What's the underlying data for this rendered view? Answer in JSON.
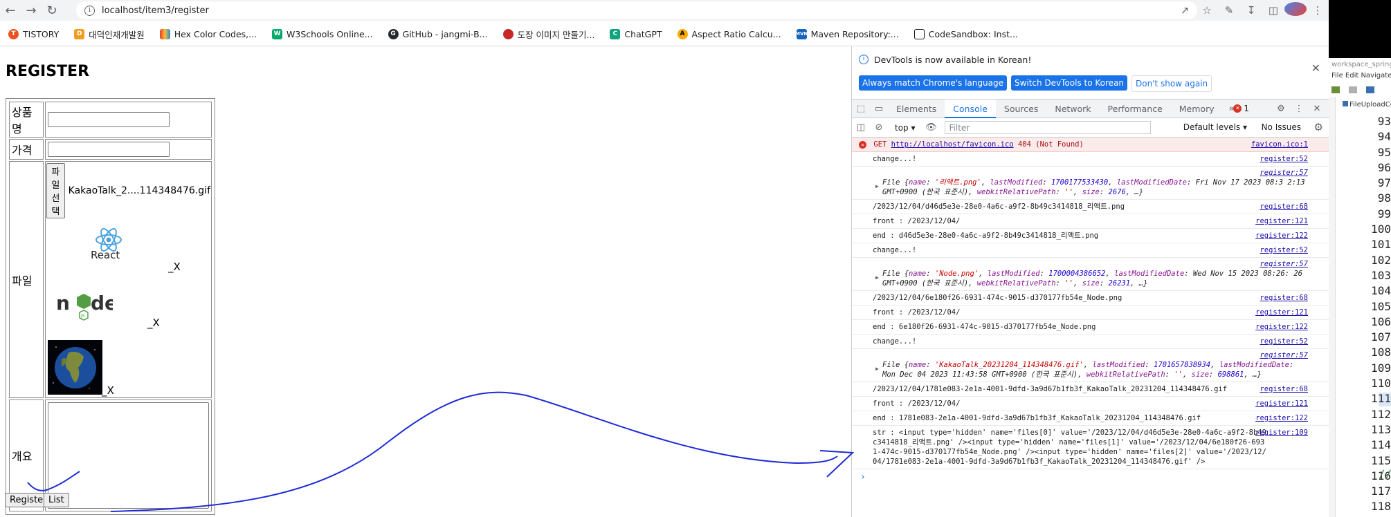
{
  "browser": {
    "url": "localhost/item3/register",
    "bookmarks": [
      {
        "label": "TISTORY",
        "color": "#eb531f",
        "glyph": "T"
      },
      {
        "label": "대덕인재개발원",
        "color": "#f29c1f",
        "glyph": "D"
      },
      {
        "label": "Hex Color Codes,...",
        "color": "#e53935",
        "glyph": "H"
      },
      {
        "label": "W3Schools Online...",
        "color": "#04aa6d",
        "glyph": "W"
      },
      {
        "label": "GitHub - jangmi-B...",
        "color": "#24292f",
        "glyph": "G"
      },
      {
        "label": "도장 이미지 만들기...",
        "color": "#c62828",
        "glyph": "도"
      },
      {
        "label": "ChatGPT",
        "color": "#10a37f",
        "glyph": "C"
      },
      {
        "label": "Aspect Ratio Calcu...",
        "color": "#f9ab00",
        "glyph": "A"
      },
      {
        "label": "Maven Repository:...",
        "color": "#1565c0",
        "glyph": "M"
      },
      {
        "label": "CodeSandbox: Inst...",
        "color": "#151515",
        "glyph": "□"
      }
    ]
  },
  "page": {
    "title": "REGISTER",
    "labels": {
      "name": "상품명",
      "price": "가격",
      "file": "파일",
      "desc": "개요"
    },
    "name_value": "",
    "price_value": "",
    "file_button": "파일 선택",
    "file_name": "KakaoTalk_2....114348476.gif",
    "thumbs": [
      {
        "name": "React",
        "x_label": "_X",
        "icon": "react-logo"
      },
      {
        "name": "node",
        "x_label": "_X",
        "icon": "node-logo"
      },
      {
        "name": "earth",
        "x_label": "_X",
        "icon": "earth-image"
      }
    ],
    "register_button": "Register",
    "list_button": "List"
  },
  "devtools": {
    "notice": "DevTools is now available in Korean!",
    "btn_match": "Always match Chrome's language",
    "btn_switch": "Switch DevTools to Korean",
    "btn_dont_show": "Don't show again",
    "tabs": [
      "Elements",
      "Console",
      "Sources",
      "Network",
      "Performance",
      "Memory"
    ],
    "active_tab": "Console",
    "error_count": "1",
    "context": "top",
    "filter_placeholder": "Filter",
    "levels": "Default levels",
    "issues": "No Issues",
    "error": {
      "method": "GET",
      "url": "http://localhost/favicon.ico",
      "status": "404 (Not Found)",
      "source": "favicon.ico:1"
    },
    "messages": [
      {
        "text": "change...!",
        "source": "register:52"
      },
      {
        "obj": true,
        "source": "register:57",
        "file_name": "'리액트.png'",
        "last_modified": "1700177533430",
        "date": "Fri Nov 17 2023 08:3 2:13 GMT+0900 (한국 표준시)",
        "size": "2676"
      },
      {
        "text": "/2023/12/04/d46d5e3e-28e0-4a6c-a9f2-8b49c3414818_리액트.png",
        "source": "register:68"
      },
      {
        "text": "front : /2023/12/04/",
        "source": "register:121"
      },
      {
        "text": "end : d46d5e3e-28e0-4a6c-a9f2-8b49c3414818_리액트.png",
        "source": "register:122"
      },
      {
        "text": "change...!",
        "source": "register:52"
      },
      {
        "obj": true,
        "source": "register:57",
        "file_name": "'Node.png'",
        "last_modified": "1700004386652",
        "date": "Wed Nov 15 2023 08:26: 26 GMT+0900 (한국 표준시)",
        "size": "26231"
      },
      {
        "text": "/2023/12/04/6e180f26-6931-474c-9015-d370177fb54e_Node.png",
        "source": "register:68"
      },
      {
        "text": "front : /2023/12/04/",
        "source": "register:121"
      },
      {
        "text": "end : 6e180f26-6931-474c-9015-d370177fb54e_Node.png",
        "source": "register:122"
      },
      {
        "text": "change...!",
        "source": "register:52"
      },
      {
        "obj": true,
        "source": "register:57",
        "file_name": "'KakaoTalk_20231204_114348476.gif'",
        "last_modified": "1701657838934",
        "date": "Mon Dec 04 2023 11:43:58 GMT+0900 (한국 표준시)",
        "size": "698861"
      },
      {
        "text": "/2023/12/04/1781e083-2e1a-4001-9dfd-3a9d67b1fb3f_KakaoTalk_20231204_114348476.gif",
        "source": "register:68"
      },
      {
        "text": "front : /2023/12/04/",
        "source": "register:121"
      },
      {
        "text": "end : 1781e083-2e1a-4001-9dfd-3a9d67b1fb3f_KakaoTalk_20231204_114348476.gif",
        "source": "register:122"
      },
      {
        "text": "str : <input type='hidden' name='files[0]' value='/2023/12/04/d46d5e3e-28e0-4a6c-a9f2-8b49c3414818_리액트.png' /><input type='hidden' name='files[1]' value='/2023/12/04/6e180f26-6931-474c-9015-d370177fb54e_Node.png' /><input type='hidden' name='files[2]' value='/2023/12/04/1781e083-2e1a-4001-9dfd-3a9d67b1fb3f_KakaoTalk_20231204_114348476.gif' />",
        "source": "register:109"
      }
    ]
  },
  "ide": {
    "title": "workspace_spring",
    "menu": "File  Edit  Navigate",
    "tab": "FileUploadCo",
    "line_numbers": [
      "93",
      "94",
      "95",
      "96",
      "97",
      "98",
      "99",
      "100",
      "101",
      "102",
      "103",
      "104",
      "105",
      "106",
      "107",
      "108",
      "109",
      "110",
      "111",
      "112",
      "113",
      "114",
      "115",
      "116",
      "117",
      "118"
    ],
    "comment": "//"
  }
}
